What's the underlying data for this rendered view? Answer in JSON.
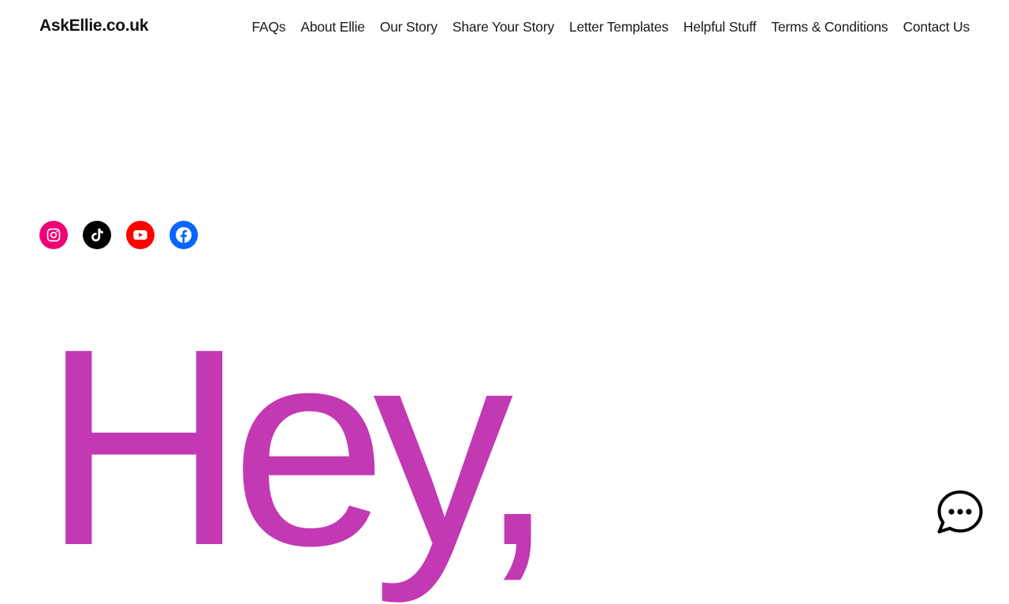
{
  "header": {
    "site_title": "AskEllie.co.uk",
    "nav": [
      {
        "label": "FAQs"
      },
      {
        "label": "About Ellie"
      },
      {
        "label": "Our Story"
      },
      {
        "label": "Share Your Story"
      },
      {
        "label": "Letter Templates"
      },
      {
        "label": "Helpful Stuff"
      },
      {
        "label": "Terms & Conditions"
      },
      {
        "label": "Contact Us"
      }
    ]
  },
  "social": [
    {
      "icon": "instagram-icon",
      "color": "#f00075"
    },
    {
      "icon": "tiktok-icon",
      "color": "#000000"
    },
    {
      "icon": "youtube-icon",
      "color": "#ff0000"
    },
    {
      "icon": "facebook-icon",
      "color": "#0866ff"
    }
  ],
  "hero": {
    "text": "Hey,",
    "color": "#c239b3"
  },
  "chat": {
    "icon": "chat-bubble-icon"
  }
}
